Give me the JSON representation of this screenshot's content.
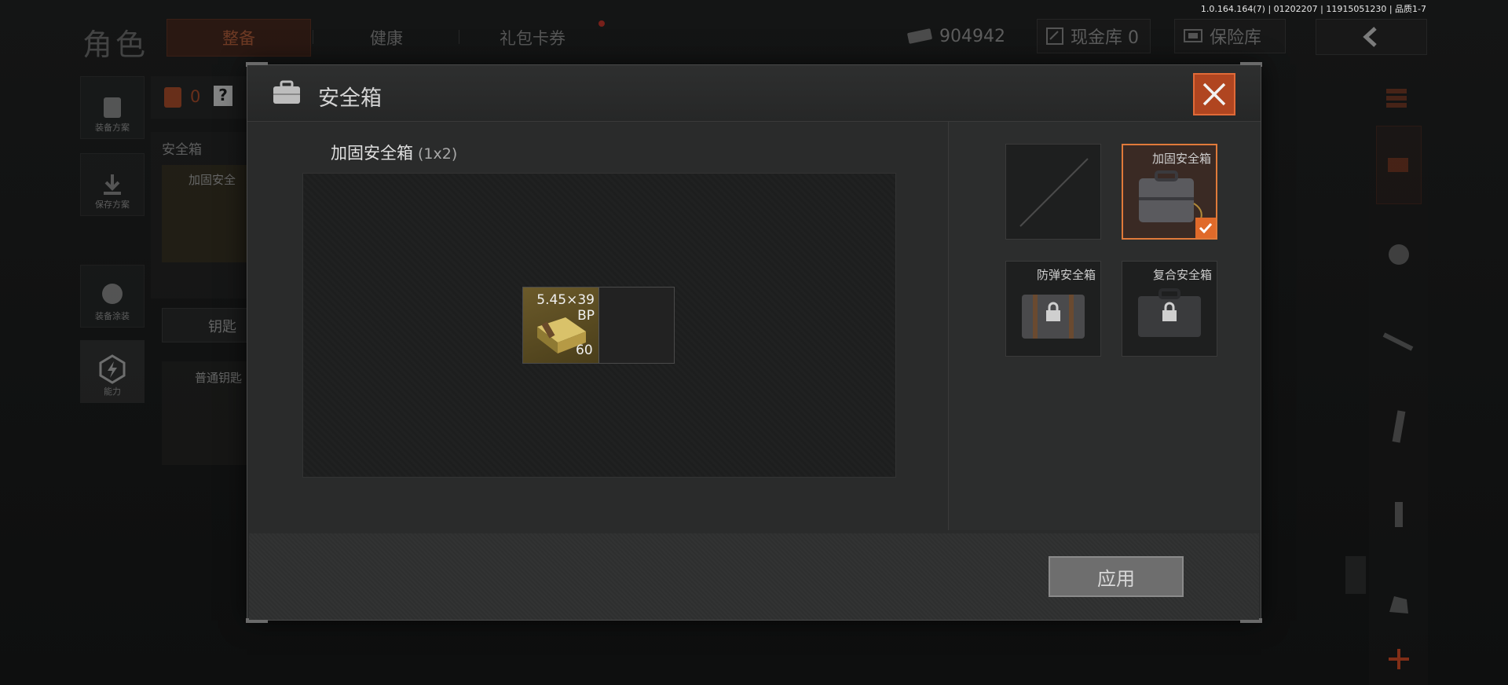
{
  "version": "1.0.164.164(7) | 01202207 | 11915051230 | 品质1-7",
  "header": {
    "title": "角色",
    "tabs": [
      {
        "label": "整备",
        "active": true
      },
      {
        "label": "健康",
        "active": false
      },
      {
        "label": "礼包卡券",
        "active": false,
        "has_badge": true
      }
    ],
    "currency_amount": "904942",
    "cash_vault_label": "现金库 0",
    "insurance_label": "保险库"
  },
  "left_sidebar": [
    {
      "label": "装备方案",
      "icon": "backpack-icon"
    },
    {
      "label": "保存方案",
      "icon": "download-icon"
    },
    {
      "label": "装备涂装",
      "icon": "helmet-icon"
    },
    {
      "label": "能力",
      "icon": "ability-icon"
    }
  ],
  "background": {
    "bag_count": "0",
    "help": "?",
    "safe_box_label": "安全箱",
    "safe_box_item_label": "加固安全",
    "key_label": "钥匙",
    "key_item_label": "普通钥匙"
  },
  "modal": {
    "title": "安全箱",
    "current_case": {
      "name": "加固安全箱",
      "size": "(1x2)"
    },
    "items": [
      {
        "name": "5.45×39\nBP",
        "count": "60"
      }
    ],
    "cases": [
      {
        "name": "",
        "state": "empty"
      },
      {
        "name": "加固安全箱",
        "state": "selected"
      },
      {
        "name": "防弹安全箱",
        "state": "locked"
      },
      {
        "name": "复合安全箱",
        "state": "locked"
      }
    ],
    "apply_label": "应用"
  },
  "colors": {
    "accent": "#e06a2a",
    "tab_active_bg": "#3d1c12",
    "close_bg": "#b04520"
  }
}
